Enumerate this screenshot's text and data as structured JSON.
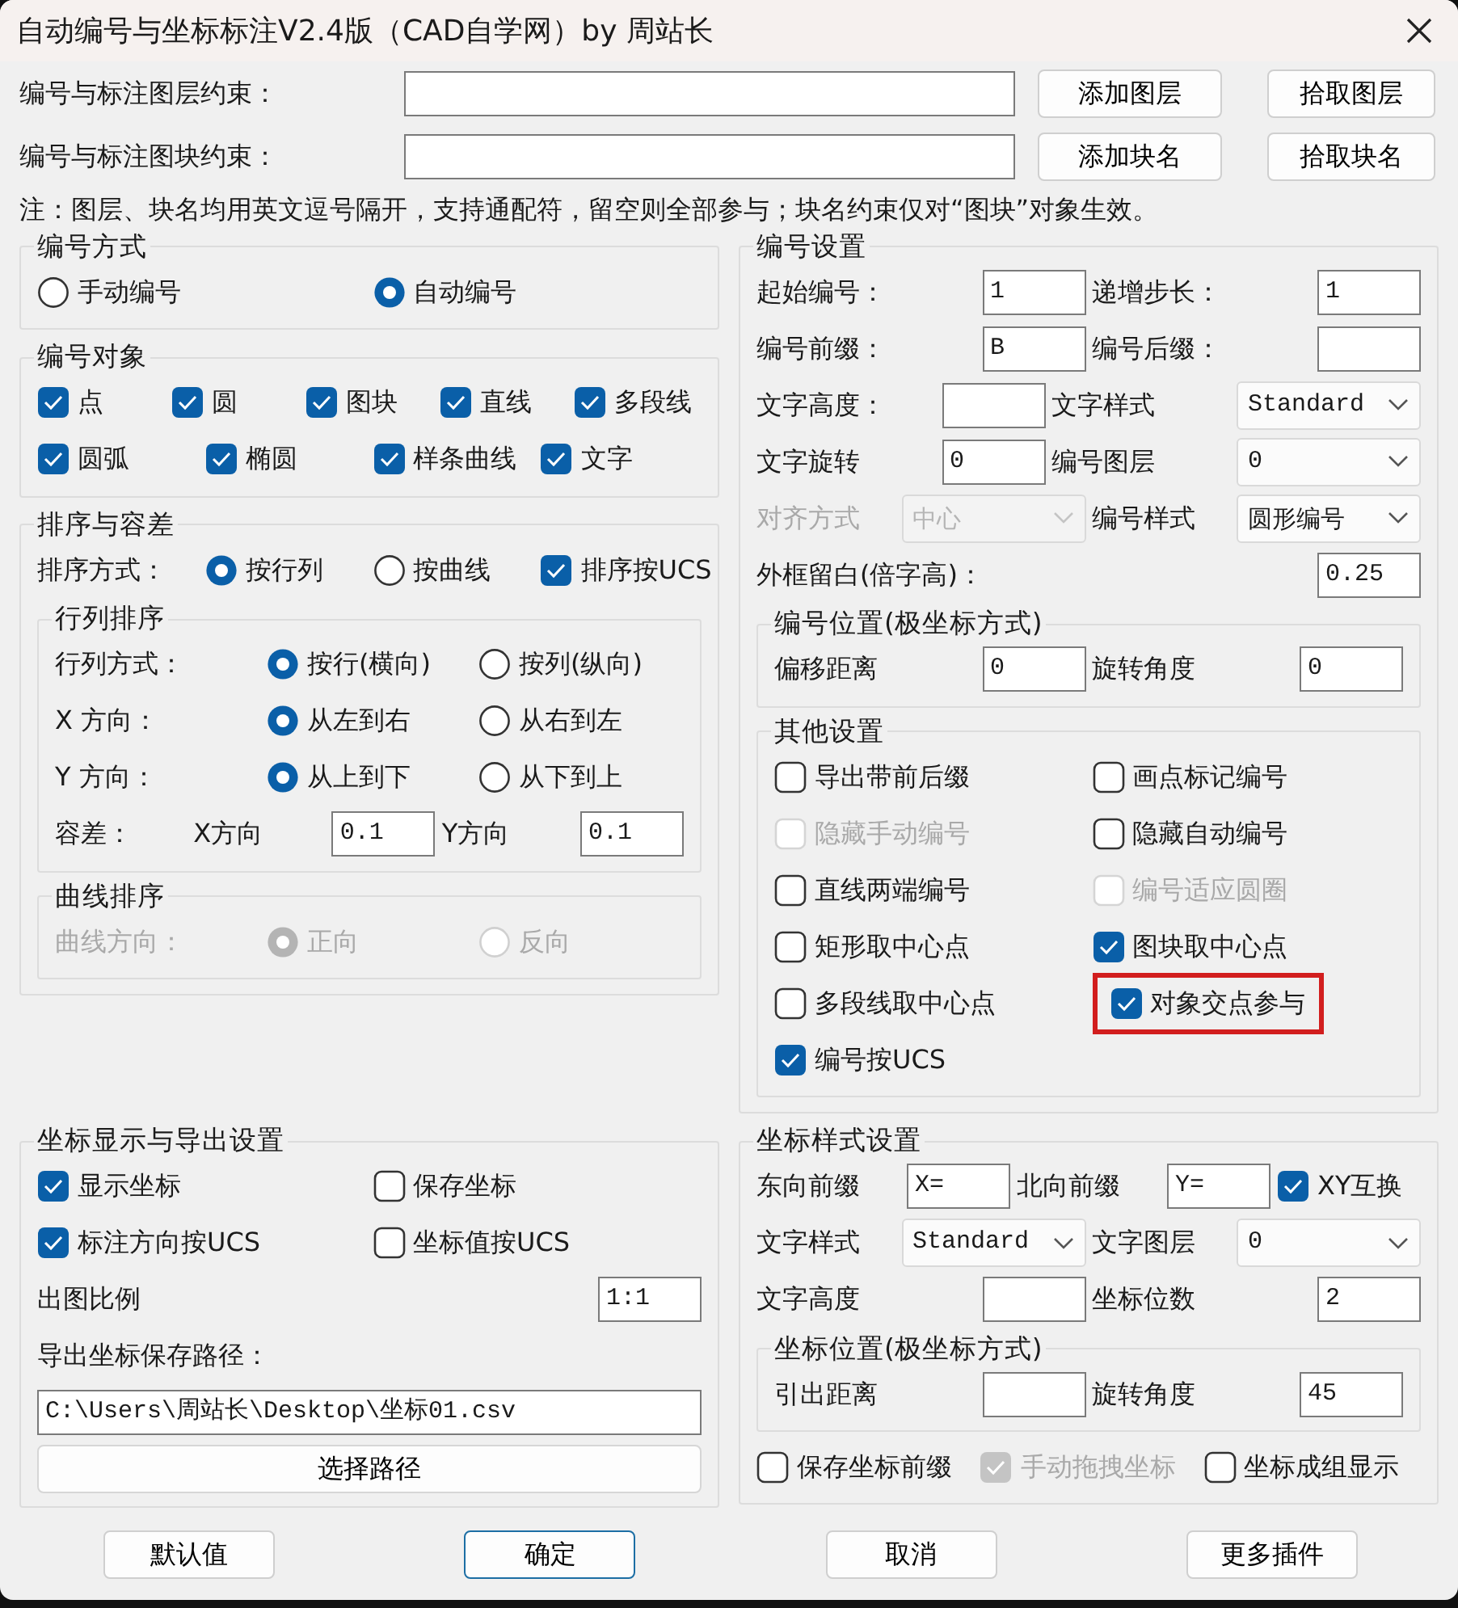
{
  "window": {
    "title": "自动编号与坐标标注V2.4版（CAD自学网）by 周站长"
  },
  "constraints": [
    {
      "label": "编号与标注图层约束：",
      "buttons": [
        "添加图层",
        "拾取图层"
      ]
    },
    {
      "label": "编号与标注图块约束：",
      "buttons": [
        "添加块名",
        "拾取块名"
      ]
    }
  ],
  "note": "注：图层、块名均用英文逗号隔开，支持通配符，留空则全部参与；块名约束仅对“图块”对象生效。",
  "upper": [
    [
      {
        "title": "编号方式",
        "children": [
          {
            "kind": "row",
            "items": [
              {
                "kind": "radio",
                "label": "手动编号",
                "selected": false,
                "disabled": false
              },
              {
                "kind": "radio",
                "label": "自动编号",
                "selected": true,
                "disabled": false
              }
            ]
          }
        ]
      },
      {
        "title": "编号对象",
        "children": [
          {
            "kind": "row",
            "items": [
              {
                "kind": "checkbox",
                "label": "点",
                "checked": true,
                "disabled": false
              },
              {
                "kind": "checkbox",
                "label": "圆",
                "checked": true,
                "disabled": false
              },
              {
                "kind": "checkbox",
                "label": "图块",
                "checked": true,
                "disabled": false
              },
              {
                "kind": "checkbox",
                "label": "直线",
                "checked": true,
                "disabled": false
              },
              {
                "kind": "checkbox",
                "label": "多段线",
                "checked": true,
                "disabled": false
              }
            ]
          },
          {
            "kind": "row",
            "items": [
              {
                "kind": "checkbox",
                "label": "圆弧",
                "checked": true,
                "disabled": false
              },
              {
                "kind": "checkbox",
                "label": "椭圆",
                "checked": true,
                "disabled": false
              },
              {
                "kind": "checkbox",
                "label": "样条曲线",
                "checked": true,
                "disabled": false
              },
              {
                "kind": "checkbox",
                "label": "文字",
                "checked": true,
                "disabled": false
              }
            ]
          }
        ]
      },
      {
        "title": "排序与容差",
        "children": [
          {
            "kind": "row",
            "items": [
              {
                "kind": "label",
                "text": "排序方式："
              },
              {
                "kind": "radio",
                "label": "按行列",
                "selected": true,
                "disabled": false
              },
              {
                "kind": "radio",
                "label": "按曲线",
                "selected": false,
                "disabled": false
              },
              {
                "kind": "checkbox",
                "label": "排序按UCS",
                "checked": true,
                "disabled": false
              }
            ]
          },
          {
            "kind": "group",
            "title": "行列排序",
            "children": [
              {
                "kind": "row",
                "items": [
                  {
                    "kind": "label",
                    "text": "行列方式："
                  },
                  {
                    "kind": "radio",
                    "label": "按行(横向)",
                    "selected": true,
                    "disabled": false
                  },
                  {
                    "kind": "radio",
                    "label": "按列(纵向)",
                    "selected": false,
                    "disabled": false
                  }
                ]
              },
              {
                "kind": "row",
                "items": [
                  {
                    "kind": "label",
                    "text": "X 方向："
                  },
                  {
                    "kind": "radio",
                    "label": "从左到右",
                    "selected": true,
                    "disabled": false
                  },
                  {
                    "kind": "radio",
                    "label": "从右到左",
                    "selected": false,
                    "disabled": false
                  }
                ]
              },
              {
                "kind": "row",
                "items": [
                  {
                    "kind": "label",
                    "text": "Y 方向："
                  },
                  {
                    "kind": "radio",
                    "label": "从上到下",
                    "selected": true,
                    "disabled": false
                  },
                  {
                    "kind": "radio",
                    "label": "从下到上",
                    "selected": false,
                    "disabled": false
                  }
                ]
              },
              {
                "kind": "row",
                "items": [
                  {
                    "kind": "label",
                    "text": "容差："
                  },
                  {
                    "kind": "label",
                    "text": "X方向"
                  },
                  {
                    "kind": "input",
                    "value": "0.1"
                  },
                  {
                    "kind": "label",
                    "text": "Y方向"
                  },
                  {
                    "kind": "input",
                    "value": "0.1"
                  }
                ]
              }
            ]
          },
          {
            "kind": "group",
            "title": "曲线排序",
            "children": [
              {
                "kind": "row",
                "items": [
                  {
                    "kind": "label",
                    "text": "曲线方向："
                  },
                  {
                    "kind": "radio",
                    "label": "正向",
                    "selected": true,
                    "disabled": true
                  },
                  {
                    "kind": "radio",
                    "label": "反向",
                    "selected": false,
                    "disabled": true
                  }
                ]
              }
            ]
          }
        ]
      }
    ],
    [
      {
        "title": "编号设置",
        "children": [
          {
            "kind": "row",
            "items": [
              {
                "kind": "label",
                "text": "起始编号："
              },
              {
                "kind": "input",
                "value": "1"
              },
              {
                "kind": "label",
                "text": "递增步长："
              },
              {
                "kind": "input",
                "value": "1"
              }
            ]
          },
          {
            "kind": "row",
            "items": [
              {
                "kind": "label",
                "text": "编号前缀："
              },
              {
                "kind": "input",
                "value": "B"
              },
              {
                "kind": "label",
                "text": "编号后缀："
              },
              {
                "kind": "input"
              }
            ]
          },
          {
            "kind": "row",
            "items": [
              {
                "kind": "label",
                "text": "文字高度："
              },
              {
                "kind": "input"
              },
              {
                "kind": "label",
                "text": "文字样式"
              },
              {
                "kind": "select",
                "value": "Standard",
                "disabled": false
              }
            ]
          },
          {
            "kind": "row",
            "items": [
              {
                "kind": "label",
                "text": "文字旋转"
              },
              {
                "kind": "input",
                "value": "0"
              },
              {
                "kind": "label",
                "text": "编号图层"
              },
              {
                "kind": "select",
                "value": "0",
                "disabled": false
              }
            ]
          },
          {
            "kind": "row",
            "items": [
              {
                "kind": "label",
                "text": "对齐方式"
              },
              {
                "kind": "select",
                "value": "中心",
                "disabled": true
              },
              {
                "kind": "label",
                "text": "编号样式"
              },
              {
                "kind": "select",
                "value": "圆形编号",
                "disabled": false
              }
            ]
          },
          {
            "kind": "row",
            "items": [
              {
                "kind": "label",
                "text": "外框留白(倍字高)："
              },
              {
                "kind": "input",
                "value": "0.25"
              }
            ]
          },
          {
            "kind": "group",
            "title": "编号位置(极坐标方式)",
            "children": [
              {
                "kind": "row",
                "items": [
                  {
                    "kind": "label",
                    "text": "偏移距离"
                  },
                  {
                    "kind": "input",
                    "value": "0"
                  },
                  {
                    "kind": "label",
                    "text": "旋转角度"
                  },
                  {
                    "kind": "input",
                    "value": "0"
                  }
                ]
              }
            ]
          },
          {
            "kind": "group",
            "title": "其他设置",
            "children": [
              {
                "kind": "row",
                "items": [
                  {
                    "kind": "checkbox",
                    "label": "导出带前后缀",
                    "checked": false,
                    "disabled": false,
                    "highlighted": false
                  },
                  {
                    "kind": "checkbox",
                    "label": "画点标记编号",
                    "checked": false,
                    "disabled": false,
                    "highlighted": false
                  }
                ]
              },
              {
                "kind": "row",
                "items": [
                  {
                    "kind": "checkbox",
                    "label": "隐藏手动编号",
                    "checked": false,
                    "disabled": true,
                    "highlighted": false
                  },
                  {
                    "kind": "checkbox",
                    "label": "隐藏自动编号",
                    "checked": false,
                    "disabled": false,
                    "highlighted": false
                  }
                ]
              },
              {
                "kind": "row",
                "items": [
                  {
                    "kind": "checkbox",
                    "label": "直线两端编号",
                    "checked": false,
                    "disabled": false,
                    "highlighted": false
                  },
                  {
                    "kind": "checkbox",
                    "label": "编号适应圆圈",
                    "checked": false,
                    "disabled": true,
                    "highlighted": false
                  }
                ]
              },
              {
                "kind": "row",
                "items": [
                  {
                    "kind": "checkbox",
                    "label": "矩形取中心点",
                    "checked": false,
                    "disabled": false,
                    "highlighted": false
                  },
                  {
                    "kind": "checkbox",
                    "label": "图块取中心点",
                    "checked": true,
                    "disabled": false,
                    "highlighted": false
                  }
                ]
              },
              {
                "kind": "row",
                "items": [
                  {
                    "kind": "checkbox",
                    "label": "多段线取中心点",
                    "checked": false,
                    "disabled": false,
                    "highlighted": false
                  },
                  {
                    "kind": "checkbox",
                    "label": "对象交点参与",
                    "checked": true,
                    "disabled": false,
                    "highlighted": true
                  }
                ]
              },
              {
                "kind": "row",
                "items": [
                  {
                    "kind": "checkbox",
                    "label": "编号按UCS",
                    "checked": true,
                    "disabled": false,
                    "highlighted": false
                  }
                ]
              }
            ]
          }
        ]
      }
    ]
  ],
  "lower": [
    [
      {
        "title": "坐标显示与导出设置",
        "children": [
          {
            "kind": "row",
            "items": [
              {
                "kind": "checkbox",
                "label": "显示坐标",
                "checked": true,
                "disabled": false
              },
              {
                "kind": "checkbox",
                "label": "保存坐标",
                "checked": false,
                "disabled": false
              }
            ]
          },
          {
            "kind": "row",
            "items": [
              {
                "kind": "checkbox",
                "label": "标注方向按UCS",
                "checked": true,
                "disabled": false
              },
              {
                "kind": "checkbox",
                "label": "坐标值按UCS",
                "checked": false,
                "disabled": false
              }
            ]
          },
          {
            "kind": "row",
            "items": [
              {
                "kind": "label",
                "text": "出图比例"
              },
              {
                "kind": "input",
                "value": "1:1"
              }
            ]
          },
          {
            "kind": "row",
            "items": [
              {
                "kind": "label",
                "text": "导出坐标保存路径："
              }
            ]
          },
          {
            "kind": "row",
            "items": [
              {
                "kind": "input",
                "value": "C:\\Users\\周站长\\Desktop\\坐标01.csv"
              }
            ]
          },
          {
            "kind": "row",
            "items": [
              {
                "kind": "button",
                "text": "选择路径"
              }
            ]
          }
        ]
      }
    ],
    [
      {
        "title": "坐标样式设置",
        "children": [
          {
            "kind": "row",
            "items": [
              {
                "kind": "label",
                "text": "东向前缀"
              },
              {
                "kind": "input",
                "value": "X="
              },
              {
                "kind": "label",
                "text": "北向前缀"
              },
              {
                "kind": "input",
                "value": "Y="
              },
              {
                "kind": "checkbox",
                "label": "XY互换",
                "checked": true,
                "disabled": false
              }
            ]
          },
          {
            "kind": "row",
            "items": [
              {
                "kind": "label",
                "text": "文字样式"
              },
              {
                "kind": "select",
                "value": "Standard",
                "disabled": false
              },
              {
                "kind": "label",
                "text": "文字图层"
              },
              {
                "kind": "select",
                "value": "0",
                "disabled": false
              }
            ]
          },
          {
            "kind": "row",
            "items": [
              {
                "kind": "label",
                "text": "文字高度"
              },
              {
                "kind": "input"
              },
              {
                "kind": "label",
                "text": "坐标位数"
              },
              {
                "kind": "input",
                "value": "2"
              }
            ]
          },
          {
            "kind": "group",
            "title": "坐标位置(极坐标方式)",
            "children": [
              {
                "kind": "row",
                "items": [
                  {
                    "kind": "label",
                    "text": "引出距离"
                  },
                  {
                    "kind": "input"
                  },
                  {
                    "kind": "label",
                    "text": "旋转角度"
                  },
                  {
                    "kind": "input",
                    "value": "45"
                  }
                ]
              }
            ]
          },
          {
            "kind": "row",
            "items": [
              {
                "kind": "checkbox",
                "label": "保存坐标前缀",
                "checked": false,
                "disabled": false
              },
              {
                "kind": "checkbox",
                "label": "手动拖拽坐标",
                "checked": true,
                "disabled": true
              },
              {
                "kind": "checkbox",
                "label": "坐标成组显示",
                "checked": false,
                "disabled": false
              }
            ]
          }
        ]
      }
    ]
  ],
  "buttons": [
    {
      "text": "默认值",
      "default": false
    },
    {
      "text": "确定",
      "default": true
    },
    {
      "text": "取消",
      "default": false
    },
    {
      "text": "更多插件",
      "default": false
    }
  ]
}
